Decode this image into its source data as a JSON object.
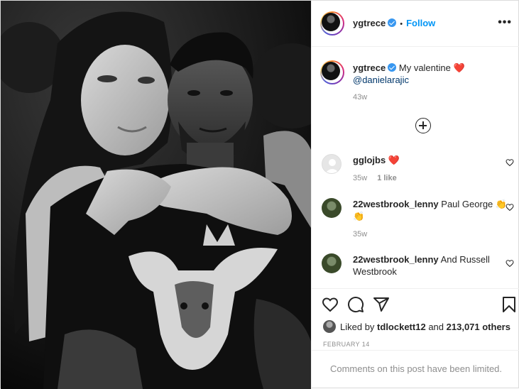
{
  "post": {
    "author": {
      "username": "ygtrece",
      "verified": true,
      "follow_label": "Follow",
      "separator": "•",
      "more_icon": "more-horizontal-icon",
      "more_label": "•••"
    },
    "photo": {
      "icon": "photo-grayscale"
    },
    "caption": {
      "username": "ygtrece",
      "text": "My valentine",
      "emoji": "❤️",
      "mention": "@danielarajic",
      "time": "43w"
    },
    "load_more_icon": "plus-circle-icon",
    "comments": [
      {
        "username": "gglojbs",
        "text": "❤️",
        "time": "35w",
        "likes": "1 like"
      },
      {
        "username": "22westbrook_lenny",
        "text": "Paul George 👏👏",
        "time": "35w",
        "likes": ""
      },
      {
        "username": "22westbrook_lenny",
        "text": "And Russell Westbrook",
        "time": "",
        "likes": ""
      }
    ],
    "actions": {
      "like_icon": "heart-icon",
      "comment_icon": "comment-icon",
      "share_icon": "share-icon",
      "save_icon": "bookmark-icon"
    },
    "likes_summary": {
      "prefix": "Liked by",
      "user": "tdlockett12",
      "conjunction": "and",
      "others": "213,071 others"
    },
    "date": "FEBRUARY 14",
    "comments_limited": "Comments on this post have been limited."
  },
  "colors": {
    "accent": "#0095f6",
    "heart": "#ed4956",
    "muted": "#8e8e8e",
    "text": "#262626",
    "verified": "#3897f0"
  }
}
